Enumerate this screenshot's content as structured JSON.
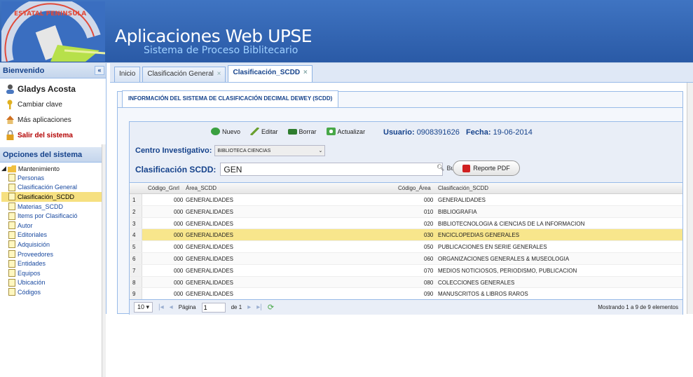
{
  "header": {
    "logo_text": "ESTATAL PENINSULA",
    "title": "Aplicaciones Web UPSE",
    "subtitle": "Sistema de Proceso Biblitecario"
  },
  "sidebar": {
    "header": "Bienvenido",
    "collapse": "«",
    "user_name": "Gladys Acosta",
    "change_password": "Cambiar clave",
    "more_apps": "Más aplicaciones",
    "logout": "Salir del sistema",
    "options_header": "Opciones del sistema",
    "tree_root": "Mantenimiento",
    "items": [
      {
        "label": "Personas"
      },
      {
        "label": "Clasificación General"
      },
      {
        "label": "Clasificación_SCDD"
      },
      {
        "label": "Materias_SCDD"
      },
      {
        "label": "Items por Clasificació"
      },
      {
        "label": "Autor"
      },
      {
        "label": "Editoriales"
      },
      {
        "label": "Adquisición"
      },
      {
        "label": "Proveedores"
      },
      {
        "label": "Entidades"
      },
      {
        "label": "Equipos"
      },
      {
        "label": "Ubicación"
      },
      {
        "label": "Códigos"
      }
    ]
  },
  "tabs": [
    {
      "label": "Inicio",
      "close": ""
    },
    {
      "label": "Clasificación General",
      "close": "×"
    },
    {
      "label": "Clasificación_SCDD",
      "close": "×"
    }
  ],
  "panel": {
    "title": "INFORMACIÓN DEL SISTEMA DE CLASIFICACIÓN DECIMAL DEWEY (SCDD)",
    "toolbar": {
      "new": "Nuevo",
      "edit": "Editar",
      "delete": "Borrar",
      "refresh": "Actualizar"
    },
    "user_label": "Usuario:",
    "user_value": "0908391626",
    "date_label": "Fecha:",
    "date_value": "19-06-2014",
    "centro_label": "Centro Investigativo:",
    "centro_value": "BIBLIOTECA CIENCIAS",
    "clas_label": "Clasificación SCDD:",
    "clas_value": "GEN",
    "search": "Buscar",
    "pdf": "Reporte PDF"
  },
  "grid": {
    "headers": [
      "Código_Gnrl",
      "Área_SCDD",
      "Código_Área",
      "Clasificación_SCDD"
    ],
    "rows": [
      [
        "1",
        "000",
        "GENERALIDADES",
        "000",
        "GENERALIDADES"
      ],
      [
        "2",
        "000",
        "GENERALIDADES",
        "010",
        "BIBLIOGRAFIA"
      ],
      [
        "3",
        "000",
        "GENERALIDADES",
        "020",
        "BIBLIOTECNOLOGIA & CIENCIAS DE LA INFORMACION"
      ],
      [
        "4",
        "000",
        "GENERALIDADES",
        "030",
        "ENCICLOPEDIAS GENERALES"
      ],
      [
        "5",
        "000",
        "GENERALIDADES",
        "050",
        "PUBLICACIONES EN SERIE GENERALES"
      ],
      [
        "6",
        "000",
        "GENERALIDADES",
        "060",
        "ORGANIZACIONES GENERALES & MUSEOLOGIA"
      ],
      [
        "7",
        "000",
        "GENERALIDADES",
        "070",
        "MEDIOS NOTICIOSOS, PERIODISMO, PUBLICACION"
      ],
      [
        "8",
        "000",
        "GENERALIDADES",
        "080",
        "COLECCIONES GENERALES"
      ],
      [
        "9",
        "000",
        "GENERALIDADES",
        "090",
        "MANUSCRITOS & LIBROS RAROS"
      ]
    ]
  },
  "pager": {
    "size": "10 ▾",
    "page_label": "Página",
    "page_value": "1",
    "of": "de 1",
    "info": "Mostrando 1 a 9 de 9 elementos"
  }
}
